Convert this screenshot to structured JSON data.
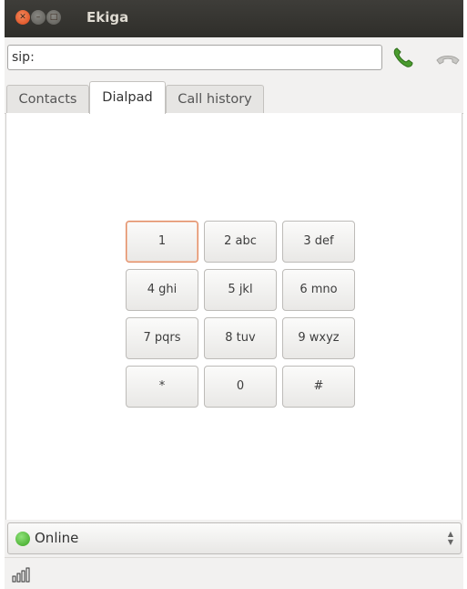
{
  "window": {
    "title": "Ekiga",
    "controls": [
      "close",
      "minimize",
      "maximize"
    ]
  },
  "call_bar": {
    "uri_value": "sip:",
    "call_icon": "phone-call-icon",
    "hangup_icon": "phone-hangup-icon"
  },
  "tabs": [
    {
      "label": "Contacts",
      "active": false
    },
    {
      "label": "Dialpad",
      "active": true
    },
    {
      "label": "Call history",
      "active": false
    }
  ],
  "dialpad": {
    "keys": [
      {
        "digit": "1",
        "letters": "",
        "focused": true
      },
      {
        "digit": "2",
        "letters": "abc"
      },
      {
        "digit": "3",
        "letters": "def"
      },
      {
        "digit": "4",
        "letters": "ghi"
      },
      {
        "digit": "5",
        "letters": "jkl"
      },
      {
        "digit": "6",
        "letters": "mno"
      },
      {
        "digit": "7",
        "letters": "pqrs"
      },
      {
        "digit": "8",
        "letters": "tuv"
      },
      {
        "digit": "9",
        "letters": "wxyz"
      },
      {
        "digit": "*",
        "letters": ""
      },
      {
        "digit": "0",
        "letters": ""
      },
      {
        "digit": "#",
        "letters": ""
      }
    ],
    "key_labels": [
      "1",
      "2 abc",
      "3 def",
      "4 ghi",
      "5 jkl",
      "6 mno",
      "7 pqrs",
      "8 tuv",
      "9 wxyz",
      "*",
      "0",
      "#"
    ]
  },
  "presence": {
    "status": "Online",
    "status_color": "#4cb82e"
  },
  "statusbar": {
    "signal_icon": "signal-strength-icon"
  },
  "colors": {
    "titlebar": "#3c3b37",
    "close_button": "#e9541f",
    "call_green": "#4a9b2e",
    "focus_border": "#e08a63"
  }
}
